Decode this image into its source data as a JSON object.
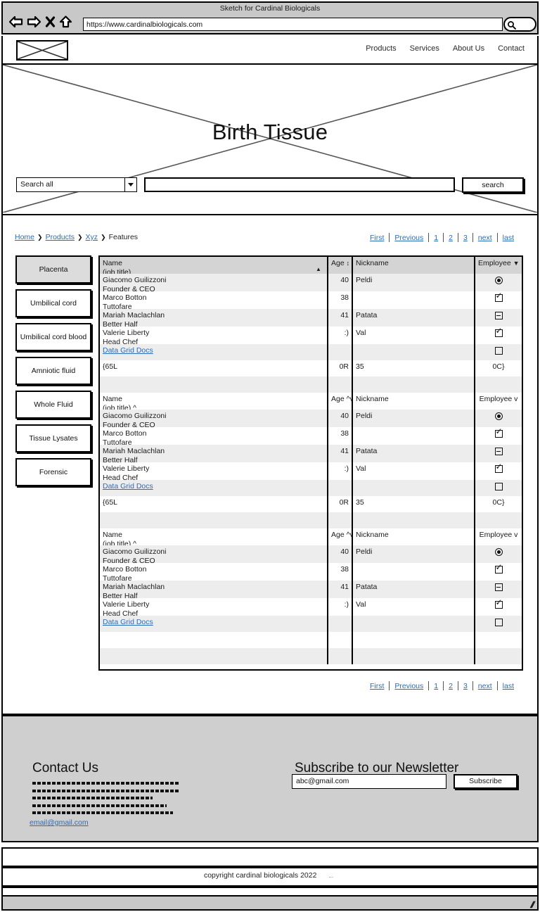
{
  "browser": {
    "title": "Sketch for Cardinal Biologicals",
    "url": "https://www.cardinalbiologicals.com",
    "icons": {
      "back": "back-arrow-icon",
      "forward": "forward-arrow-icon",
      "stop": "stop-x-icon",
      "home": "home-icon",
      "search": "search-magnifier-icon"
    }
  },
  "header": {
    "logo": "logo-placeholder",
    "nav": [
      "Products",
      "Services",
      "About Us",
      "Contact"
    ]
  },
  "hero": {
    "title": "Birth Tissue",
    "select_value": "Search all",
    "search_input_value": "",
    "search_button": "search"
  },
  "breadcrumb": {
    "items": [
      "Home",
      "Products",
      "Xyz",
      "Features"
    ],
    "separator": "❯"
  },
  "pagination": {
    "first": "First",
    "previous": "Previous",
    "pages": [
      "1",
      "2",
      "3"
    ],
    "next": "next",
    "last": "last"
  },
  "sidebar": {
    "items": [
      {
        "label": "Placenta",
        "active": true
      },
      {
        "label": "Umbilical cord",
        "active": false
      },
      {
        "label": "Umbilical cord blood",
        "active": false
      },
      {
        "label": "Amniotic fluid",
        "active": false
      },
      {
        "label": "Whole Fluid",
        "active": false
      },
      {
        "label": "Tissue Lysates",
        "active": false
      },
      {
        "label": "Forensic",
        "active": false
      }
    ]
  },
  "grid": {
    "block1": {
      "header": {
        "name": "Name",
        "name_sub": "(job title)",
        "name_sort": "▲",
        "age": "Age",
        "age_sort": "↕",
        "nickname": "Nickname",
        "employee": "Employee",
        "employee_sort": "▼"
      },
      "rows": [
        {
          "name": "Giacomo Guilizzoni",
          "sub": "Founder & CEO",
          "age": "40",
          "nickname": "Peldi",
          "employee": "radio"
        },
        {
          "name": "Marco Botton",
          "sub": "Tuttofare",
          "age": "38",
          "nickname": "",
          "employee": "checked"
        },
        {
          "name": "Mariah Maclachlan",
          "sub": "Better Half",
          "age": "41",
          "nickname": "Patata",
          "employee": "indeterminate"
        },
        {
          "name": "Valerie Liberty",
          "sub": "Head Chef",
          "age": ":)",
          "nickname": "Val",
          "employee": "checked"
        },
        {
          "name": "Data Grid Docs",
          "sub": "",
          "age": "",
          "nickname": "",
          "employee": "unchecked",
          "link": true
        },
        {
          "name": "{65L",
          "sub": "",
          "age": "0R",
          "nickname": "35",
          "employee": "0C}"
        },
        {
          "name": "",
          "sub": "",
          "age": "",
          "nickname": "",
          "employee": ""
        }
      ]
    },
    "block2": {
      "header": {
        "name": "Name",
        "name_sub": "(job title) ^",
        "age": "Age ^v",
        "nickname": "Nickname",
        "employee": "Employee v"
      },
      "rows": [
        {
          "name": "Giacomo Guilizzoni",
          "sub": "Founder & CEO",
          "age": "40",
          "nickname": "Peldi",
          "employee": "radio"
        },
        {
          "name": "Marco Botton",
          "sub": "Tuttofare",
          "age": "38",
          "nickname": "",
          "employee": "checked"
        },
        {
          "name": "Mariah Maclachlan",
          "sub": "Better Half",
          "age": "41",
          "nickname": "Patata",
          "employee": "indeterminate"
        },
        {
          "name": "Valerie Liberty",
          "sub": "Head Chef",
          "age": ":)",
          "nickname": "Val",
          "employee": "checked"
        },
        {
          "name": "Data Grid Docs",
          "sub": "",
          "age": "",
          "nickname": "",
          "employee": "unchecked",
          "link": true
        },
        {
          "name": "{65L",
          "sub": "",
          "age": "0R",
          "nickname": "35",
          "employee": "0C}"
        },
        {
          "name": "",
          "sub": "",
          "age": "",
          "nickname": "",
          "employee": ""
        }
      ]
    },
    "block3": {
      "header": {
        "name": "Name",
        "name_sub": "(job title) ^",
        "age": "Age ^v",
        "nickname": "Nickname",
        "employee": "Employee v"
      },
      "rows": [
        {
          "name": "Giacomo Guilizzoni",
          "sub": "Founder & CEO",
          "age": "40",
          "nickname": "Peldi",
          "employee": "radio"
        },
        {
          "name": "Marco Botton",
          "sub": "Tuttofare",
          "age": "38",
          "nickname": "",
          "employee": "checked"
        },
        {
          "name": "Mariah Maclachlan",
          "sub": "Better Half",
          "age": "41",
          "nickname": "Patata",
          "employee": "indeterminate"
        },
        {
          "name": "Valerie Liberty",
          "sub": "Head Chef",
          "age": ":)",
          "nickname": "Val",
          "employee": "checked"
        },
        {
          "name": "Data Grid Docs",
          "sub": "",
          "age": "",
          "nickname": "",
          "employee": "unchecked",
          "link": true
        },
        {
          "name": "",
          "sub": "",
          "age": "",
          "nickname": "",
          "employee": ""
        },
        {
          "name": "",
          "sub": "",
          "age": "",
          "nickname": "",
          "employee": ""
        }
      ]
    }
  },
  "footer": {
    "contact_heading": "Contact Us",
    "newsletter_heading": "Subscribe to our Newsletter",
    "email_link": "email@gmail.com",
    "newsletter_value": "abc@gmail.com",
    "subscribe_button": "Subscribe",
    "scribble_lines": 5
  },
  "bottom": {
    "copyright": "copyright cardinal biologicals 2022",
    "dots": "..."
  },
  "colors": {
    "link": "#2b6cb8",
    "chrome_bg": "#c8c8c8",
    "footer_bg": "#cfcfcf",
    "header_row": "#d4d4d4",
    "zebra_row": "#ededed",
    "active_btn": "#dcdcdc"
  }
}
